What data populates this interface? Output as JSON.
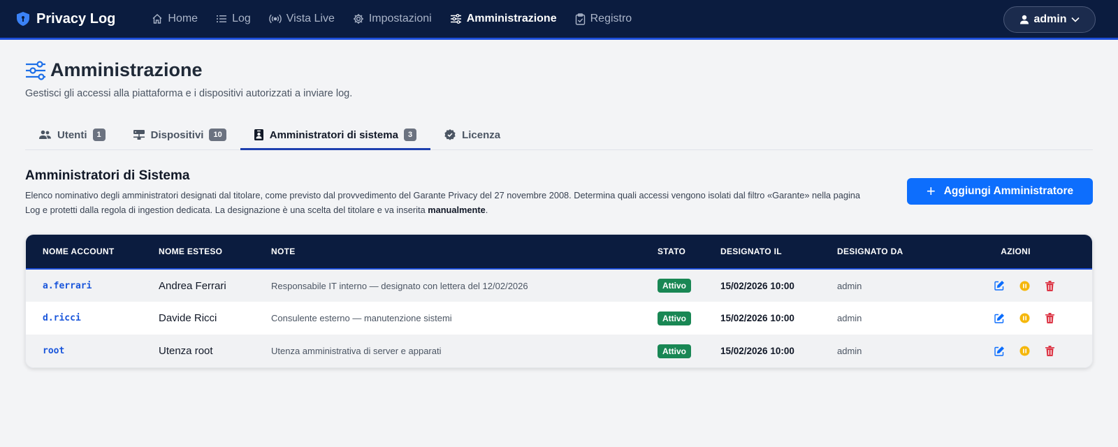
{
  "nav": {
    "brand": "Privacy Log",
    "items": [
      {
        "label": "Home"
      },
      {
        "label": "Log"
      },
      {
        "label": "Vista Live"
      },
      {
        "label": "Impostazioni"
      },
      {
        "label": "Amministrazione"
      },
      {
        "label": "Registro"
      }
    ],
    "user": "admin"
  },
  "header": {
    "title": "Amministrazione",
    "subtitle": "Gestisci gli accessi alla piattaforma e i dispositivi autorizzati a inviare log."
  },
  "tabs": [
    {
      "label": "Utenti",
      "count": "1"
    },
    {
      "label": "Dispositivi",
      "count": "10"
    },
    {
      "label": "Amministratori di sistema",
      "count": "3"
    },
    {
      "label": "Licenza"
    }
  ],
  "section": {
    "title": "Amministratori di Sistema",
    "desc_part1": "Elenco nominativo degli amministratori designati dal titolare, come previsto dal provvedimento del Garante Privacy del 27 novembre 2008. Determina quali accessi vengono isolati dal filtro «Garante» nella pagina Log e protetti dalla regola di ingestion dedicata. La designazione è una scelta del titolare e va inserita ",
    "desc_bold": "manualmente",
    "desc_end": ".",
    "add_button": "Aggiungi Amministratore"
  },
  "table": {
    "headers": {
      "account": "NOME ACCOUNT",
      "fullname": "NOME ESTESO",
      "note": "NOTE",
      "status": "STATO",
      "designated_on": "DESIGNATO IL",
      "designated_by": "DESIGNATO DA",
      "actions": "AZIONI"
    },
    "rows": [
      {
        "account": "a.ferrari",
        "fullname": "Andrea Ferrari",
        "note": "Responsabile IT interno — designato con lettera del 12/02/2026",
        "status": "Attivo",
        "designated_on": "15/02/2026 10:00",
        "designated_by": "admin"
      },
      {
        "account": "d.ricci",
        "fullname": "Davide Ricci",
        "note": "Consulente esterno — manutenzione sistemi",
        "status": "Attivo",
        "designated_on": "15/02/2026 10:00",
        "designated_by": "admin"
      },
      {
        "account": "root",
        "fullname": "Utenza root",
        "note": "Utenza amministrativa di server e apparati",
        "status": "Attivo",
        "designated_on": "15/02/2026 10:00",
        "designated_by": "admin"
      }
    ]
  },
  "colors": {
    "navbar_bg": "#0b1c3f",
    "accent": "#0d6efd",
    "status_active": "#198754",
    "edit_icon": "#0d6efd",
    "pause_icon": "#f5b70b",
    "delete_icon": "#dc3545"
  },
  "icons": {
    "brand": "shield-icon",
    "home": "home-icon",
    "log": "list-icon",
    "live": "broadcast-icon",
    "settings": "gear-icon",
    "admin": "sliders-icon",
    "registry": "clipboard-check-icon",
    "user": "person-icon",
    "users_tab": "people-icon",
    "devices_tab": "hdd-network-icon",
    "sysadmin_tab": "person-badge-icon",
    "license_tab": "patch-check-icon",
    "edit": "edit-icon",
    "pause": "pause-icon",
    "delete": "trash-icon"
  }
}
